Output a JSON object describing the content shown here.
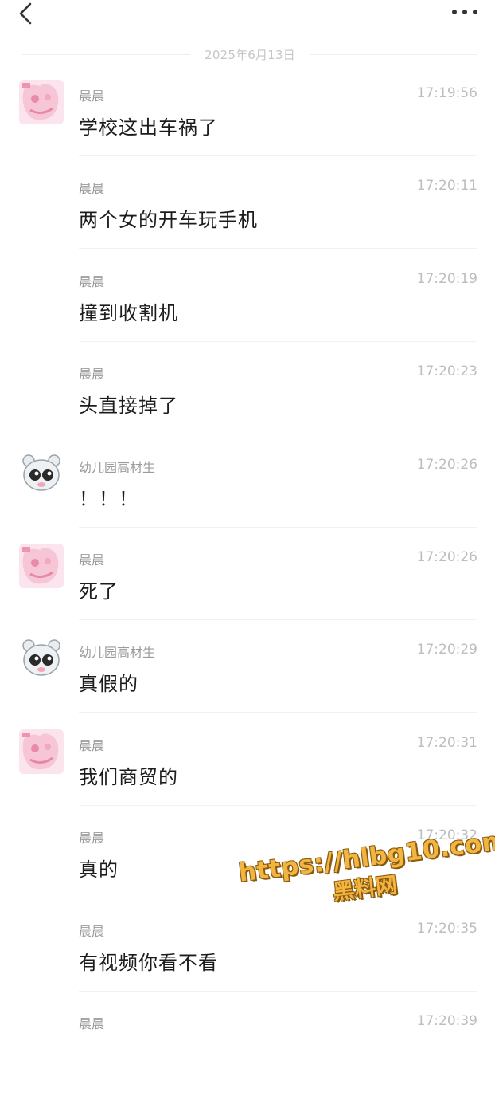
{
  "header": {
    "back_icon": "chevron-left-icon",
    "more_icon": "more-horizontal-icon"
  },
  "date_separator": "2025年6月13日",
  "colors": {
    "sender": "#9b9b9b",
    "time": "#bdbdbd",
    "message": "#1c1c1c",
    "watermark": "#f2b53f"
  },
  "messages": [
    {
      "sender": "晨晨",
      "time": "17:19:56",
      "text": "学校这出车祸了",
      "avatar": "pink-girl-avatar",
      "show_avatar": true
    },
    {
      "sender": "晨晨",
      "time": "17:20:11",
      "text": "两个女的开车玩手机",
      "avatar": "",
      "show_avatar": false
    },
    {
      "sender": "晨晨",
      "time": "17:20:19",
      "text": "撞到收割机",
      "avatar": "",
      "show_avatar": false
    },
    {
      "sender": "晨晨",
      "time": "17:20:23",
      "text": "头直接掉了",
      "avatar": "",
      "show_avatar": false
    },
    {
      "sender": "幼儿园高材生",
      "time": "17:20:26",
      "text": "！！！",
      "avatar": "bear-avatar",
      "show_avatar": true
    },
    {
      "sender": "晨晨",
      "time": "17:20:26",
      "text": "死了",
      "avatar": "pink-girl-avatar",
      "show_avatar": true
    },
    {
      "sender": "幼儿园高材生",
      "time": "17:20:29",
      "text": "真假的",
      "avatar": "bear-avatar",
      "show_avatar": true
    },
    {
      "sender": "晨晨",
      "time": "17:20:31",
      "text": "我们商贸的",
      "avatar": "pink-girl-avatar",
      "show_avatar": true
    },
    {
      "sender": "晨晨",
      "time": "17:20:32",
      "text": "真的",
      "avatar": "",
      "show_avatar": false
    },
    {
      "sender": "晨晨",
      "time": "17:20:35",
      "text": "有视频你看不看",
      "avatar": "",
      "show_avatar": false
    },
    {
      "sender": "晨晨",
      "time": "17:20:39",
      "text": "",
      "avatar": "",
      "show_avatar": false
    }
  ],
  "watermark": {
    "url": "https://hlbg10.com",
    "label": "黑料网"
  }
}
